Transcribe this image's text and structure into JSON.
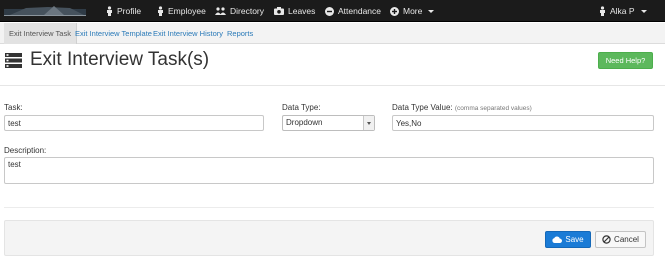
{
  "navbar": {
    "items": [
      {
        "label": "Profile",
        "icon": "person-icon"
      },
      {
        "label": "Employee",
        "icon": "person-icon"
      },
      {
        "label": "Directory",
        "icon": "users-icon"
      },
      {
        "label": "Leaves",
        "icon": "camera-icon"
      },
      {
        "label": "Attendance",
        "icon": "minus-circle-icon"
      },
      {
        "label": "More",
        "icon": "plus-circle-icon"
      }
    ],
    "user": {
      "label": "Alka P",
      "icon": "person-icon"
    }
  },
  "subnav": {
    "items": [
      {
        "label": "Exit Interview Task",
        "active": true
      },
      {
        "label": "Exit Interview Template",
        "active": false
      },
      {
        "label": "Exit Interview History",
        "active": false
      },
      {
        "label": "Reports",
        "active": false
      }
    ]
  },
  "page": {
    "title": "Exit Interview Task(s)",
    "help_label": "Need Help?"
  },
  "form": {
    "task_label": "Task:",
    "task_value": "test",
    "data_type_label": "Data Type:",
    "data_type_value": "Dropdown",
    "data_type_value_label": "Data Type Value:",
    "data_type_value_hint": "(comma separated values)",
    "data_type_value_value": "Yes,No",
    "description_label": "Description:",
    "description_value": "test"
  },
  "actions": {
    "save_label": "Save",
    "cancel_label": "Cancel"
  },
  "colors": {
    "navbar_bg": "#1b1b1b",
    "link": "#2a7ab8",
    "success": "#5cb85c",
    "primary": "#1a7bd6"
  }
}
